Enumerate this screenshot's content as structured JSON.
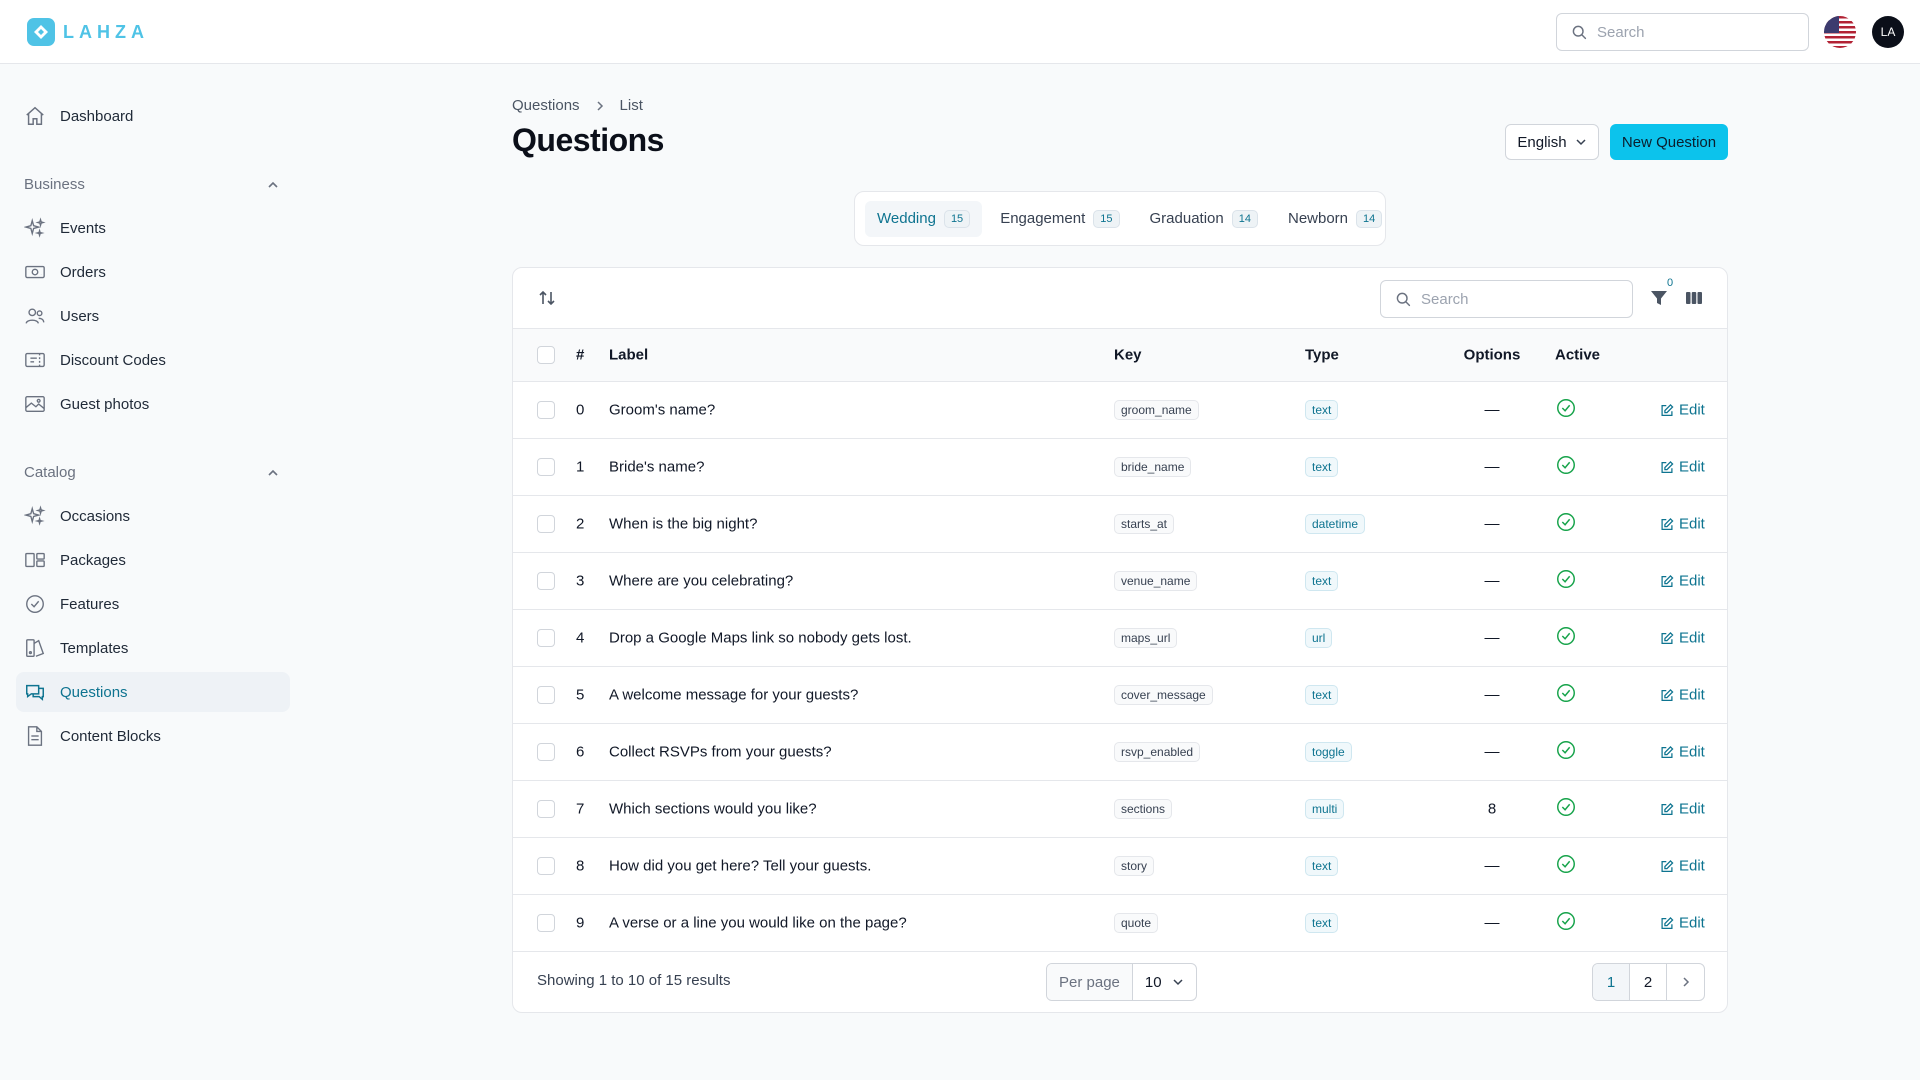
{
  "app": {
    "brand": "LAHZA"
  },
  "topbar": {
    "search_placeholder": "Search",
    "avatar_initials": "LA"
  },
  "sidebar": {
    "dashboard": "Dashboard",
    "business_group": "Business",
    "business_items": [
      {
        "label": "Events",
        "icon": "sparkles-icon"
      },
      {
        "label": "Orders",
        "icon": "cash-icon"
      },
      {
        "label": "Users",
        "icon": "users-icon"
      },
      {
        "label": "Discount Codes",
        "icon": "ticket-icon"
      },
      {
        "label": "Guest photos",
        "icon": "photo-icon"
      }
    ],
    "catalog_group": "Catalog",
    "catalog_items": [
      {
        "label": "Occasions",
        "icon": "sparkles-icon"
      },
      {
        "label": "Packages",
        "icon": "packages-icon"
      },
      {
        "label": "Features",
        "icon": "check-badge-icon"
      },
      {
        "label": "Templates",
        "icon": "templates-icon"
      },
      {
        "label": "Questions",
        "icon": "chat-icon",
        "active": true
      },
      {
        "label": "Content Blocks",
        "icon": "document-icon"
      }
    ]
  },
  "breadcrumb": {
    "parent": "Questions",
    "current": "List"
  },
  "header": {
    "title": "Questions",
    "language": "English",
    "new_button": "New Question"
  },
  "tabs": [
    {
      "label": "Wedding",
      "count": "15",
      "active": true
    },
    {
      "label": "Engagement",
      "count": "15"
    },
    {
      "label": "Graduation",
      "count": "14"
    },
    {
      "label": "Newborn",
      "count": "14"
    }
  ],
  "table": {
    "search_placeholder": "Search",
    "filter_count": "0",
    "columns": {
      "num": "#",
      "label": "Label",
      "key": "Key",
      "type": "Type",
      "options": "Options",
      "active": "Active"
    },
    "edit_label": "Edit",
    "rows": [
      {
        "num": "0",
        "label": "Groom's name?",
        "key": "groom_name",
        "type": "text",
        "options": "—"
      },
      {
        "num": "1",
        "label": "Bride's name?",
        "key": "bride_name",
        "type": "text",
        "options": "—"
      },
      {
        "num": "2",
        "label": "When is the big night?",
        "key": "starts_at",
        "type": "datetime",
        "options": "—"
      },
      {
        "num": "3",
        "label": "Where are you celebrating?",
        "key": "venue_name",
        "type": "text",
        "options": "—"
      },
      {
        "num": "4",
        "label": "Drop a Google Maps link so nobody gets lost.",
        "key": "maps_url",
        "type": "url",
        "options": "—"
      },
      {
        "num": "5",
        "label": "A welcome message for your guests?",
        "key": "cover_message",
        "type": "text",
        "options": "—"
      },
      {
        "num": "6",
        "label": "Collect RSVPs from your guests?",
        "key": "rsvp_enabled",
        "type": "toggle",
        "options": "—"
      },
      {
        "num": "7",
        "label": "Which sections would you like?",
        "key": "sections",
        "type": "multi",
        "options": "8"
      },
      {
        "num": "8",
        "label": "How did you get here? Tell your guests.",
        "key": "story",
        "type": "text",
        "options": "—"
      },
      {
        "num": "9",
        "label": "A verse or a line you would like on the page?",
        "key": "quote",
        "type": "text",
        "options": "—"
      }
    ],
    "footer": {
      "showing": "Showing 1 to 10 of 15 results",
      "per_page_label": "Per page",
      "per_page_value": "10",
      "pages": [
        "1",
        "2"
      ]
    }
  },
  "colors": {
    "accent": "#0cc3ec",
    "link": "#0e7490",
    "success": "#16a34a"
  }
}
